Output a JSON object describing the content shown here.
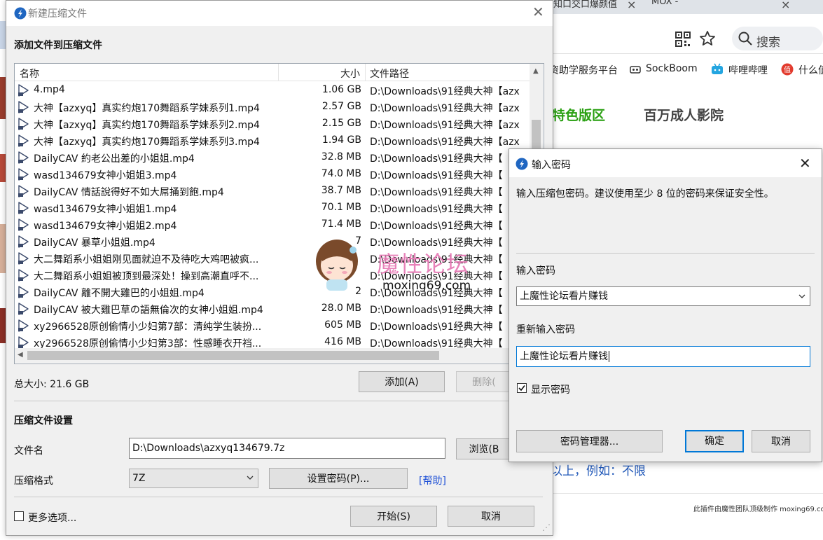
{
  "browser": {
    "tabs": [
      "知口交口爆颜值",
      "MOX -"
    ],
    "search_label": "搜索",
    "bookmarks": [
      "资助学服务平台",
      "SockBoom",
      "哔哩哔哩",
      "什么值"
    ],
    "section_tabs": [
      "特色版区",
      "百万成人影院"
    ],
    "page_text": "以上，例如：不限",
    "plugin_credit": "此插件由魔性团队顶级制作 moxing69.com"
  },
  "main_dialog": {
    "title": "新建压缩文件",
    "heading": "添加文件到压缩文件",
    "columns": {
      "name": "名称",
      "size": "大小",
      "path": "文件路径"
    },
    "files": [
      {
        "name": "4.mp4",
        "size": "1.06 GB",
        "path": "D:\\Downloads\\91经典大神【azx"
      },
      {
        "name": "大神【azxyq】真实约炮170舞蹈系学妹系列1.mp4",
        "size": "2.57 GB",
        "path": "D:\\Downloads\\91经典大神【azx"
      },
      {
        "name": "大神【azxyq】真实约炮170舞蹈系学妹系列2.mp4",
        "size": "2.15 GB",
        "path": "D:\\Downloads\\91经典大神【azx"
      },
      {
        "name": "大神【azxyq】真实约炮170舞蹈系学妹系列3.mp4",
        "size": "1.94 GB",
        "path": "D:\\Downloads\\91经典大神【azx"
      },
      {
        "name": "DailyCAV 約老公出差的小姐姐.mp4",
        "size": "32.8 MB",
        "path": "D:\\Downloads\\91经典大神【"
      },
      {
        "name": "wasd134679女神小姐姐3.mp4",
        "size": "74.0 MB",
        "path": "D:\\Downloads\\91经典大神【"
      },
      {
        "name": "DailyCAV 情話說得好不如大屌捅到飽.mp4",
        "size": "38.7 MB",
        "path": "D:\\Downloads\\91经典大神【"
      },
      {
        "name": "wasd134679女神小姐姐1.mp4",
        "size": "70.1 MB",
        "path": "D:\\Downloads\\91经典大神【"
      },
      {
        "name": "wasd134679女神小姐姐2.mp4",
        "size": "71.4 MB",
        "path": "D:\\Downloads\\91经典大神【"
      },
      {
        "name": "DailyCAV 暴草小姐姐.mp4",
        "size": "7",
        "path": "D:\\Downloads\\91经典大神【"
      },
      {
        "name": "大二舞蹈系小姐姐刚见面就迫不及待吃大鸡吧被疯...",
        "size": "",
        "path": "D:\\Downloads\\91经典大神【"
      },
      {
        "name": "大二舞蹈系小姐姐被顶到最深处！操到高潮直呼不...",
        "size": "",
        "path": "D:\\Downloads\\91经典大神【"
      },
      {
        "name": "DailyCAV 離不開大雞巴的小姐姐.mp4",
        "size": "2",
        "path": "D:\\Downloads\\91经典大神【"
      },
      {
        "name": "DailyCAV 被大雞巴草の語無倫次的女神小姐姐.mp4",
        "size": "28.0 MB",
        "path": "D:\\Downloads\\91经典大神【"
      },
      {
        "name": "xy2966528原创偷情小少妇第7部：清纯学生装扮...",
        "size": "605 MB",
        "path": "D:\\Downloads\\91经典大神【"
      },
      {
        "name": "xy2966528原创偷情小少妇第3部：性感睡衣开裆...",
        "size": "416 MB",
        "path": "D:\\Downloads\\91经典大神【"
      }
    ],
    "total_size": "总大小: 21.6 GB",
    "add_button": "添加(A)",
    "delete_button": "删除(",
    "settings_heading": "压缩文件设置",
    "filename_label": "文件名",
    "filename_value": "D:\\Downloads\\azxyq134679.7z",
    "browse_button": "浏览(B",
    "format_label": "压缩格式",
    "format_value": "7Z",
    "set_password_button": "设置密码(P)...",
    "help_link": "[帮助]",
    "more_options_label": "更多选项...",
    "start_button": "开始(S)",
    "cancel_button": "取消"
  },
  "watermark": {
    "cn": "魔性论坛",
    "en": "moxing69.com"
  },
  "password_dialog": {
    "title": "输入密码",
    "description": "输入压缩包密码。建议使用至少 8 位的密码来保证安全性。",
    "password_label": "输入密码",
    "password_value": "上魔性论坛看片赚钱",
    "repeat_label": "重新输入密码",
    "repeat_value": "上魔性论坛看片赚钱",
    "show_password_label": "显示密码",
    "show_password_checked": true,
    "manager_button": "密码管理器...",
    "ok_button": "确定",
    "cancel_button": "取消"
  },
  "colors": {
    "accent": "#0078d7",
    "link": "#1d4fd6",
    "section_green": "#2aa012",
    "watermark_pink": "#e77db7"
  }
}
